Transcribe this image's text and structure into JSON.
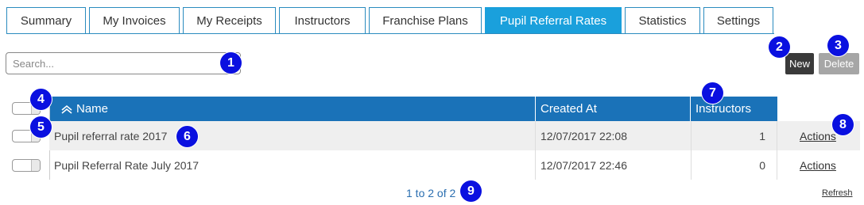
{
  "tabs": [
    {
      "label": "Summary",
      "active": false
    },
    {
      "label": "My Invoices",
      "active": false
    },
    {
      "label": "My Receipts",
      "active": false
    },
    {
      "label": "Instructors",
      "active": false
    },
    {
      "label": "Franchise Plans",
      "active": false
    },
    {
      "label": "Pupil Referral Rates",
      "active": true
    },
    {
      "label": "Statistics",
      "active": false
    },
    {
      "label": "Settings",
      "active": false
    }
  ],
  "search": {
    "placeholder": "Search...",
    "value": ""
  },
  "buttons": {
    "new_label": "New",
    "delete_label": "Delete"
  },
  "table": {
    "columns": {
      "name": "Name",
      "created_at": "Created At",
      "instructors": "Instructors"
    },
    "rows": [
      {
        "name": "Pupil referral rate 2017",
        "created_at": "12/07/2017 22:08",
        "instructors": "1",
        "actions": "Actions"
      },
      {
        "name": "Pupil Referral Rate July 2017",
        "created_at": "12/07/2017 22:46",
        "instructors": "0",
        "actions": "Actions"
      }
    ]
  },
  "pager": {
    "text": "1 to 2 of 2"
  },
  "refresh_label": "Refresh",
  "badges": [
    "1",
    "2",
    "3",
    "4",
    "5",
    "6",
    "7",
    "8",
    "9"
  ],
  "colors": {
    "active_tab": "#1aa0dc",
    "header": "#1a72b8",
    "badge": "#0a10e0",
    "new_button": "#3a3a3a",
    "delete_button": "#a6a6a6"
  }
}
